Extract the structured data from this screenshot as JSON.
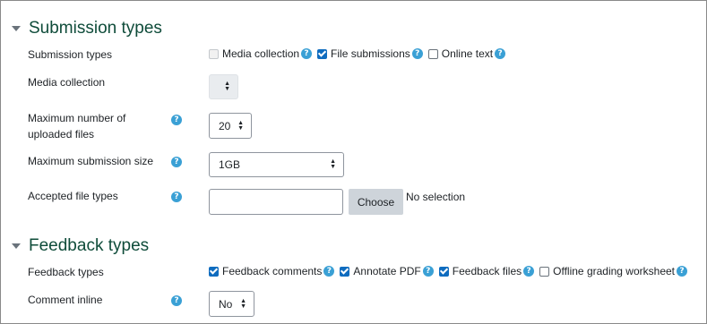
{
  "submission": {
    "title": "Submission types",
    "types_label": "Submission types",
    "options": [
      {
        "label": "Media collection",
        "checked": false,
        "disabled": true
      },
      {
        "label": "File submissions",
        "checked": true,
        "disabled": false
      },
      {
        "label": "Online text",
        "checked": false,
        "disabled": false
      }
    ],
    "media_collection_label": "Media collection",
    "max_files_label_line1": "Maximum number of",
    "max_files_label_line2": "uploaded files",
    "max_files_value": "20",
    "max_size_label": "Maximum submission size",
    "max_size_value": "1GB",
    "accepted_label": "Accepted file types",
    "choose_button": "Choose",
    "no_selection": "No selection"
  },
  "feedback": {
    "title": "Feedback types",
    "types_label": "Feedback types",
    "options": [
      {
        "label": "Feedback comments",
        "checked": true
      },
      {
        "label": "Annotate PDF",
        "checked": true
      },
      {
        "label": "Feedback files",
        "checked": true
      },
      {
        "label": "Offline grading worksheet",
        "checked": false
      }
    ],
    "comment_inline_label": "Comment inline",
    "comment_inline_value": "No"
  },
  "help_icon": "?",
  "colors": {
    "heading": "#0f4c3a",
    "accent": "#0f6cbf",
    "help": "#3aa0d5"
  }
}
